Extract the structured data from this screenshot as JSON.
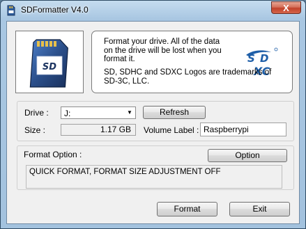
{
  "window": {
    "title": "SDFormatter V4.0",
    "close_glyph": "X"
  },
  "info": {
    "warning": "Format your drive. All of the data\non the drive will be lost when you\nformat it.",
    "trademark": "SD, SDHC and SDXC Logos are trademarks of\nSD-3C, LLC.",
    "logo_text": "SDXC"
  },
  "drive": {
    "label": "Drive :",
    "value": "J:",
    "refresh_label": "Refresh"
  },
  "size": {
    "label": "Size  :",
    "value": "1.17  GB"
  },
  "volume": {
    "label": "Volume Label :",
    "value": "Raspberrypi"
  },
  "format_option": {
    "label": "Format Option :",
    "button_label": "Option",
    "summary": "QUICK FORMAT, FORMAT SIZE ADJUSTMENT OFF"
  },
  "actions": {
    "format_label": "Format",
    "exit_label": "Exit"
  },
  "colors": {
    "title_bar": "#a9c7e2",
    "close_button": "#c1412a",
    "sd_card_body": "#2b4f8a"
  },
  "icons": {
    "app": "sd-card-icon",
    "card": "sd-card-image",
    "dropdown": "chevron-down-icon"
  }
}
